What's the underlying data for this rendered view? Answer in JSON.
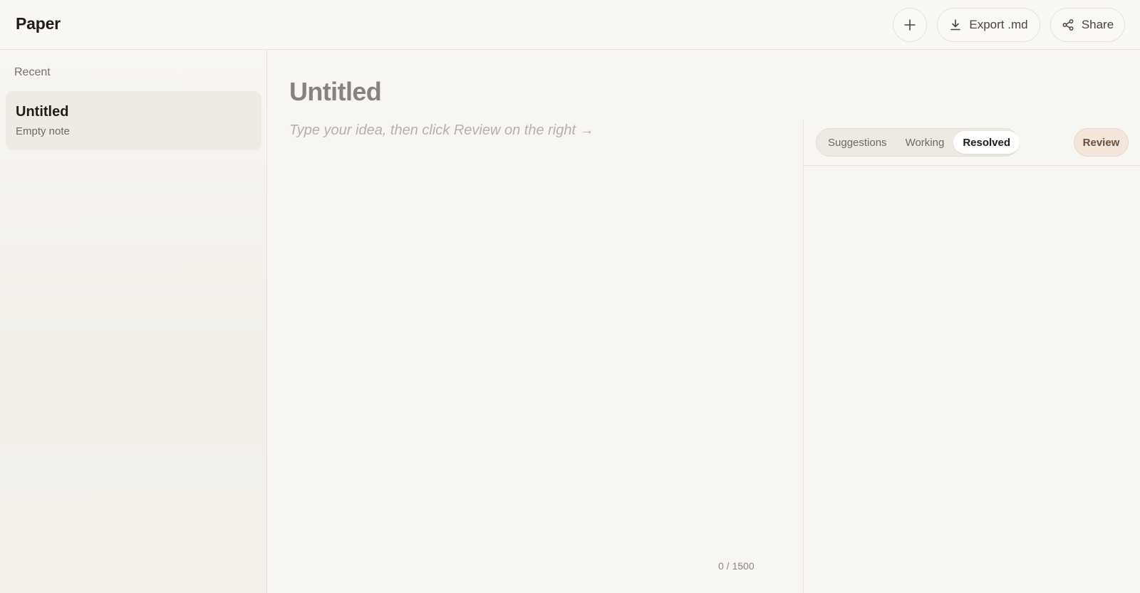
{
  "header": {
    "brand": "Paper",
    "new_button": {
      "icon": "plus-icon"
    },
    "export_button": {
      "icon": "download-icon",
      "label": "Export .md"
    },
    "share_button": {
      "icon": "share-icon",
      "label": "Share"
    }
  },
  "sidebar": {
    "section_label": "Recent",
    "notes": [
      {
        "title": "Untitled",
        "subtitle": "Empty note"
      }
    ]
  },
  "editor": {
    "title": "Untitled",
    "body_value": "",
    "body_placeholder": "Type your idea, then click Review on the right →",
    "char_count": "0 / 1500"
  },
  "review_panel": {
    "tabs": [
      "Suggestions",
      "Working",
      "Resolved"
    ],
    "active_tab": "Resolved",
    "review_label": "Review"
  },
  "colors": {
    "background": "#f8f6f2",
    "accent": "#f3e6dc"
  }
}
